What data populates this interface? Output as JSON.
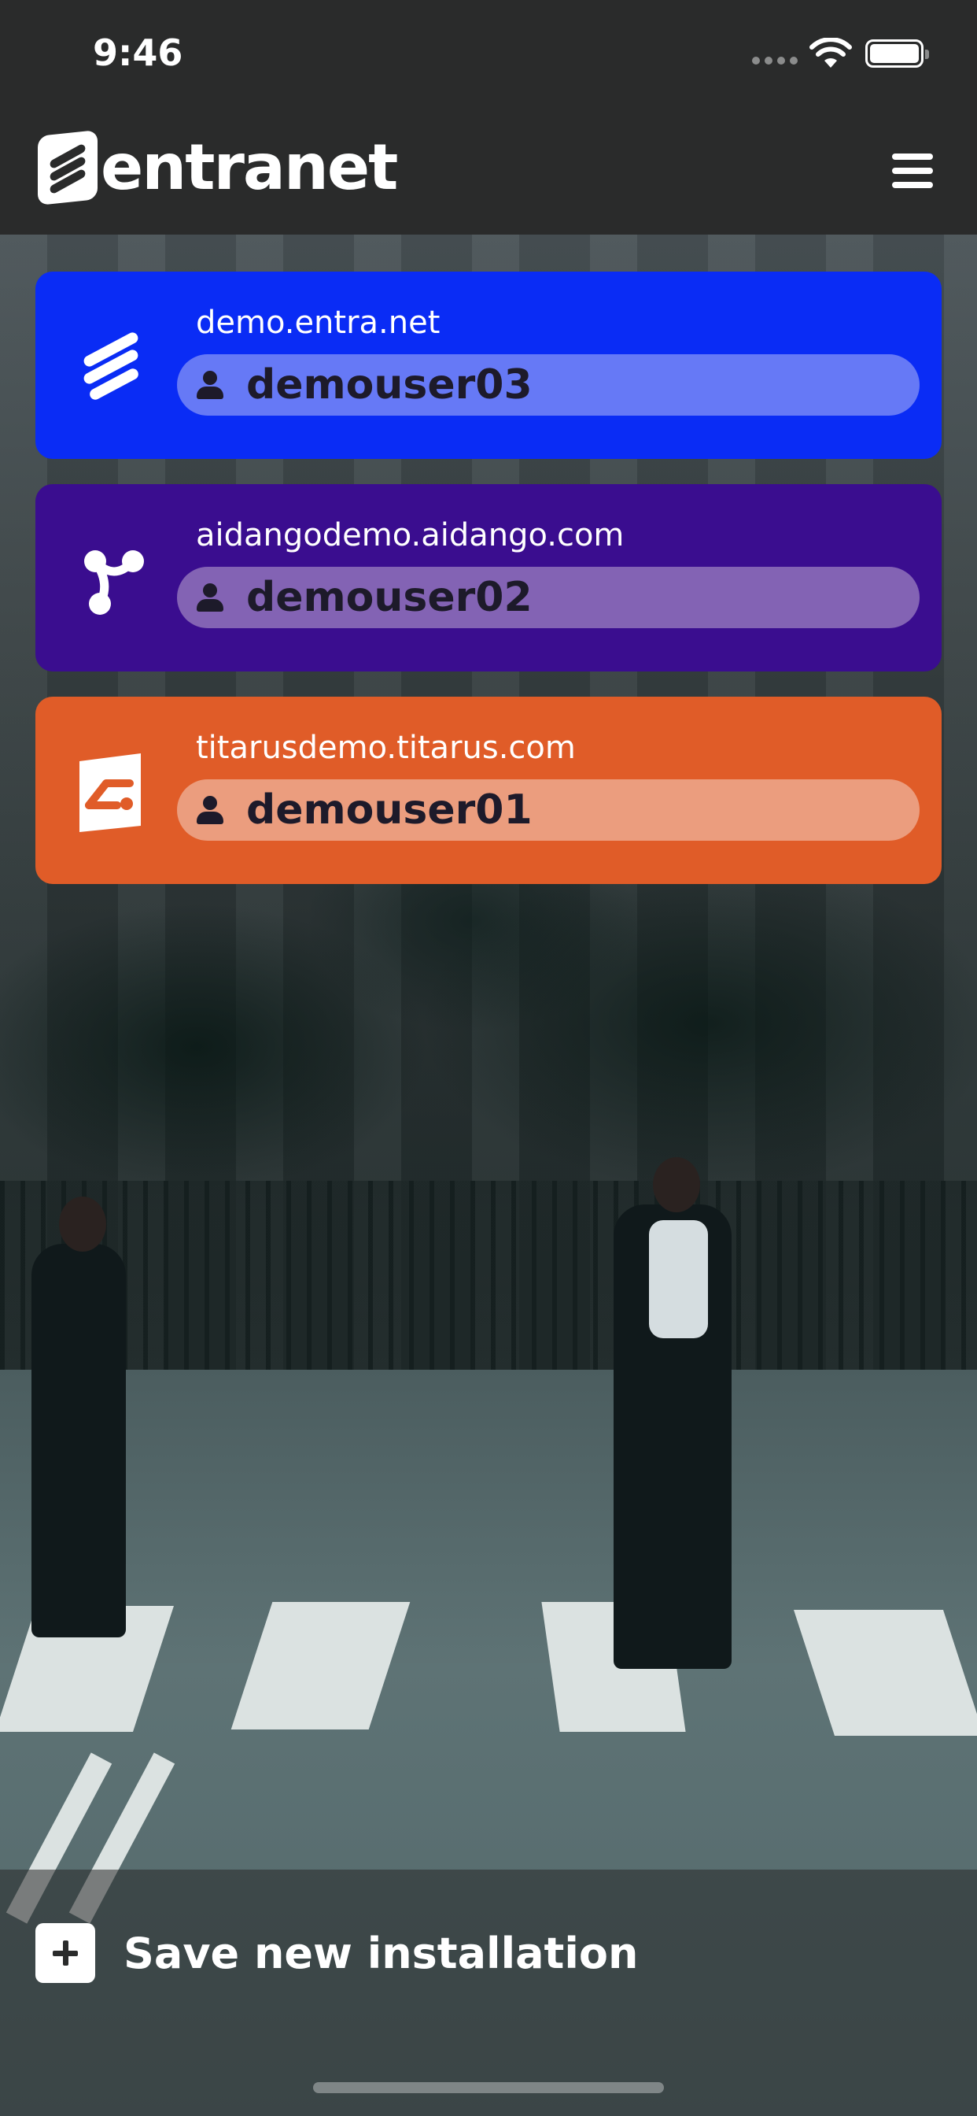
{
  "status_bar": {
    "time": "9:46",
    "icons": [
      "signal-dots-icon",
      "wifi-icon",
      "battery-icon"
    ]
  },
  "header": {
    "logo_text": "entranet",
    "menu_icon": "hamburger-menu-icon"
  },
  "installations": [
    {
      "domain": "demo.entra.net",
      "user": "demouser03",
      "icon": "entranet-logo-icon",
      "card_color": "#0a2cf5",
      "pill_color": "#6679f6"
    },
    {
      "domain": "aidangodemo.aidango.com",
      "user": "demouser02",
      "icon": "aidango-logo-icon",
      "card_color": "#3a0d8f",
      "pill_color": "#8363b4"
    },
    {
      "domain": "titarusdemo.titarus.com",
      "user": "demouser01",
      "icon": "titarus-logo-icon",
      "card_color": "#e05c28",
      "pill_color": "#eb9d7e"
    }
  ],
  "bottom": {
    "save_label": "Save new installation",
    "save_icon": "plus-icon"
  }
}
